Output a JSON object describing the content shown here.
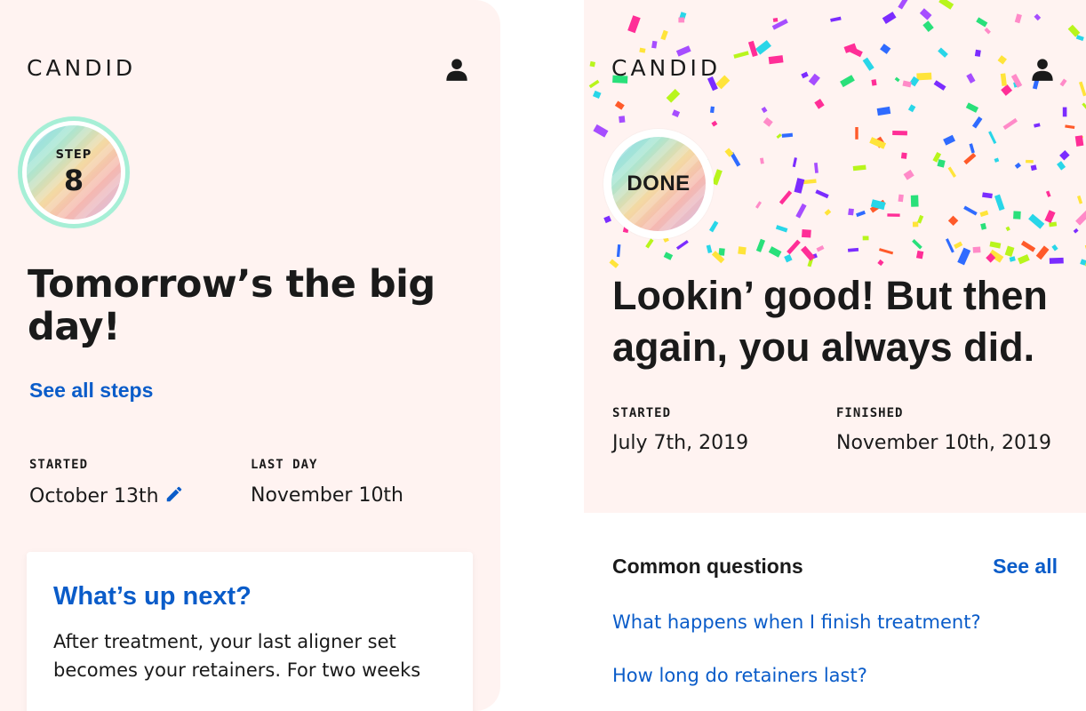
{
  "colors": {
    "background_blush": "#fff3f1",
    "link_blue": "#0a5cc9",
    "text_dark": "#1a1a1a",
    "ring_mint": "#a6efd6"
  },
  "left_screen": {
    "logo": "CANDID",
    "profile_icon": "person-icon",
    "badge": {
      "label": "STEP",
      "number": "8"
    },
    "headline": "Tomorrow’s the big day!",
    "see_all_steps": "See all steps",
    "started": {
      "label": "STARTED",
      "value": "October 13th",
      "edit_icon": "pencil-icon"
    },
    "last_day": {
      "label": "LAST DAY",
      "value": "November 10th"
    },
    "card": {
      "title": "What’s up next?",
      "body": "After treatment, your last aligner set becomes your retainers. For two weeks"
    }
  },
  "right_screen": {
    "logo": "CANDID",
    "profile_icon": "person-icon",
    "badge": {
      "label": "DONE"
    },
    "headline": "Lookin’ good! But then again, you always did.",
    "started": {
      "label": "STARTED",
      "value": "July 7th, 2019"
    },
    "finished": {
      "label": "FINISHED",
      "value": "November 10th, 2019"
    },
    "faq": {
      "heading": "Common questions",
      "see_all": "See all",
      "questions": [
        "What happens when I finish treatment?",
        "How long do retainers last?"
      ]
    }
  }
}
